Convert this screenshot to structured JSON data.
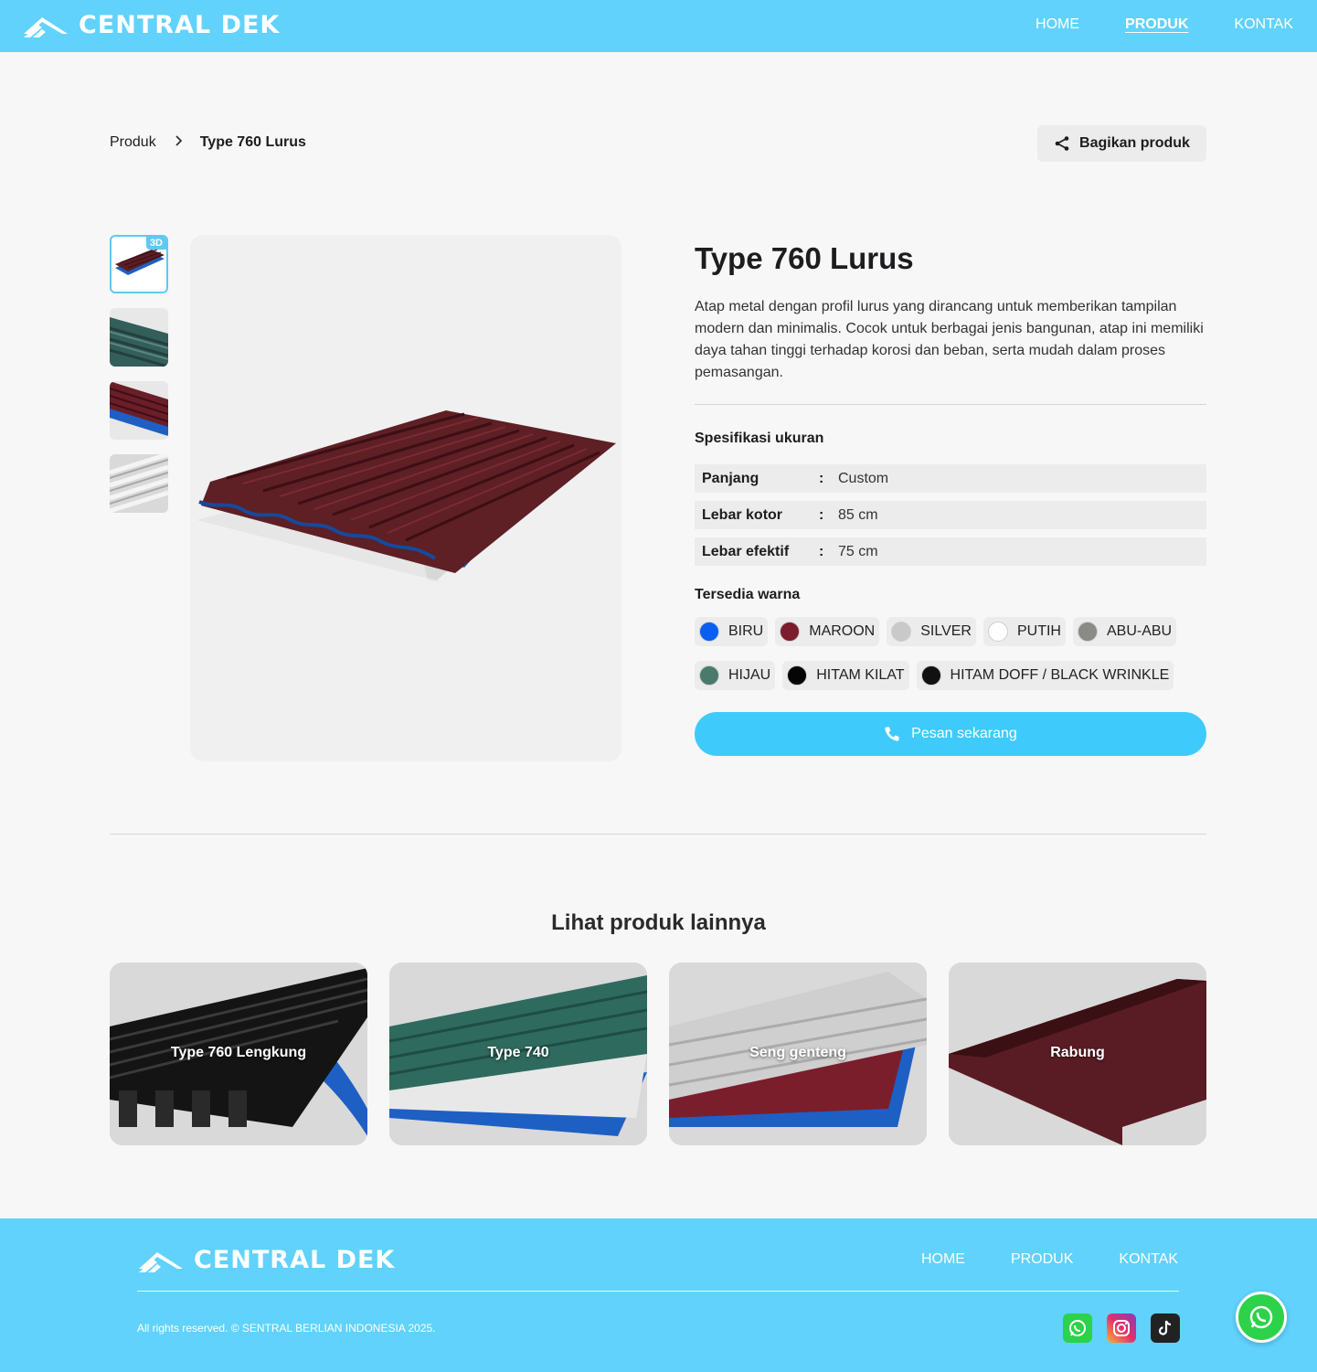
{
  "brand": {
    "name": "CENTRAL DEK",
    "primary_color": "#60d2fc",
    "button_color": "#3ecbfc"
  },
  "nav": [
    {
      "label": "HOME",
      "active": false
    },
    {
      "label": "PRODUK",
      "active": true
    },
    {
      "label": "KONTAK",
      "active": false
    }
  ],
  "breadcrumb": {
    "parent": "Produk",
    "current": "Type 760 Lurus"
  },
  "share": {
    "label": "Bagikan produk",
    "icon": "share-icon"
  },
  "gallery": {
    "badge": "3D",
    "thumbnails": [
      "maroon-blue-sheet-3d",
      "green-sheet",
      "maroon-blue-sheet",
      "silver-sheet"
    ]
  },
  "product": {
    "title": "Type 760 Lurus",
    "description": "Atap metal dengan profil lurus yang dirancang untuk memberikan tampilan modern dan minimalis. Cocok untuk berbagai jenis bangunan, atap ini memiliki daya tahan tinggi terhadap korosi dan beban, serta mudah dalam proses pemasangan.",
    "spec_title": "Spesifikasi ukuran",
    "specs": [
      {
        "key": "Panjang",
        "sep": ":",
        "value": "Custom"
      },
      {
        "key": "Lebar kotor",
        "sep": ":",
        "value": "85 cm"
      },
      {
        "key": "Lebar efektif",
        "sep": ":",
        "value": "75 cm"
      }
    ],
    "colors_title": "Tersedia warna",
    "colors": [
      {
        "label": "BIRU",
        "hex": "#0a5ef0"
      },
      {
        "label": "MAROON",
        "hex": "#7d1c2c"
      },
      {
        "label": "SILVER",
        "hex": "#c9c9c9"
      },
      {
        "label": "PUTIH",
        "hex": "#ffffff"
      },
      {
        "label": "ABU-ABU",
        "hex": "#8a8a86"
      },
      {
        "label": "HIJAU",
        "hex": "#4a7a6c"
      },
      {
        "label": "HITAM KILAT",
        "hex": "#050505"
      },
      {
        "label": "HITAM DOFF / BLACK WRINKLE",
        "hex": "#111111"
      }
    ],
    "order_label": "Pesan sekarang",
    "order_icon": "phone-icon"
  },
  "more": {
    "title": "Lihat produk lainnya",
    "items": [
      {
        "label": "Type 760 Lengkung"
      },
      {
        "label": "Type 740"
      },
      {
        "label": "Seng genteng"
      },
      {
        "label": "Rabung"
      }
    ]
  },
  "footer": {
    "brand": "CENTRAL DEK",
    "nav": [
      "HOME",
      "PRODUK",
      "KONTAK"
    ],
    "copyright": "All rights reserved. © SENTRAL BERLIAN INDONESIA 2025.",
    "social": [
      "whatsapp-icon",
      "instagram-icon",
      "tiktok-icon"
    ]
  }
}
